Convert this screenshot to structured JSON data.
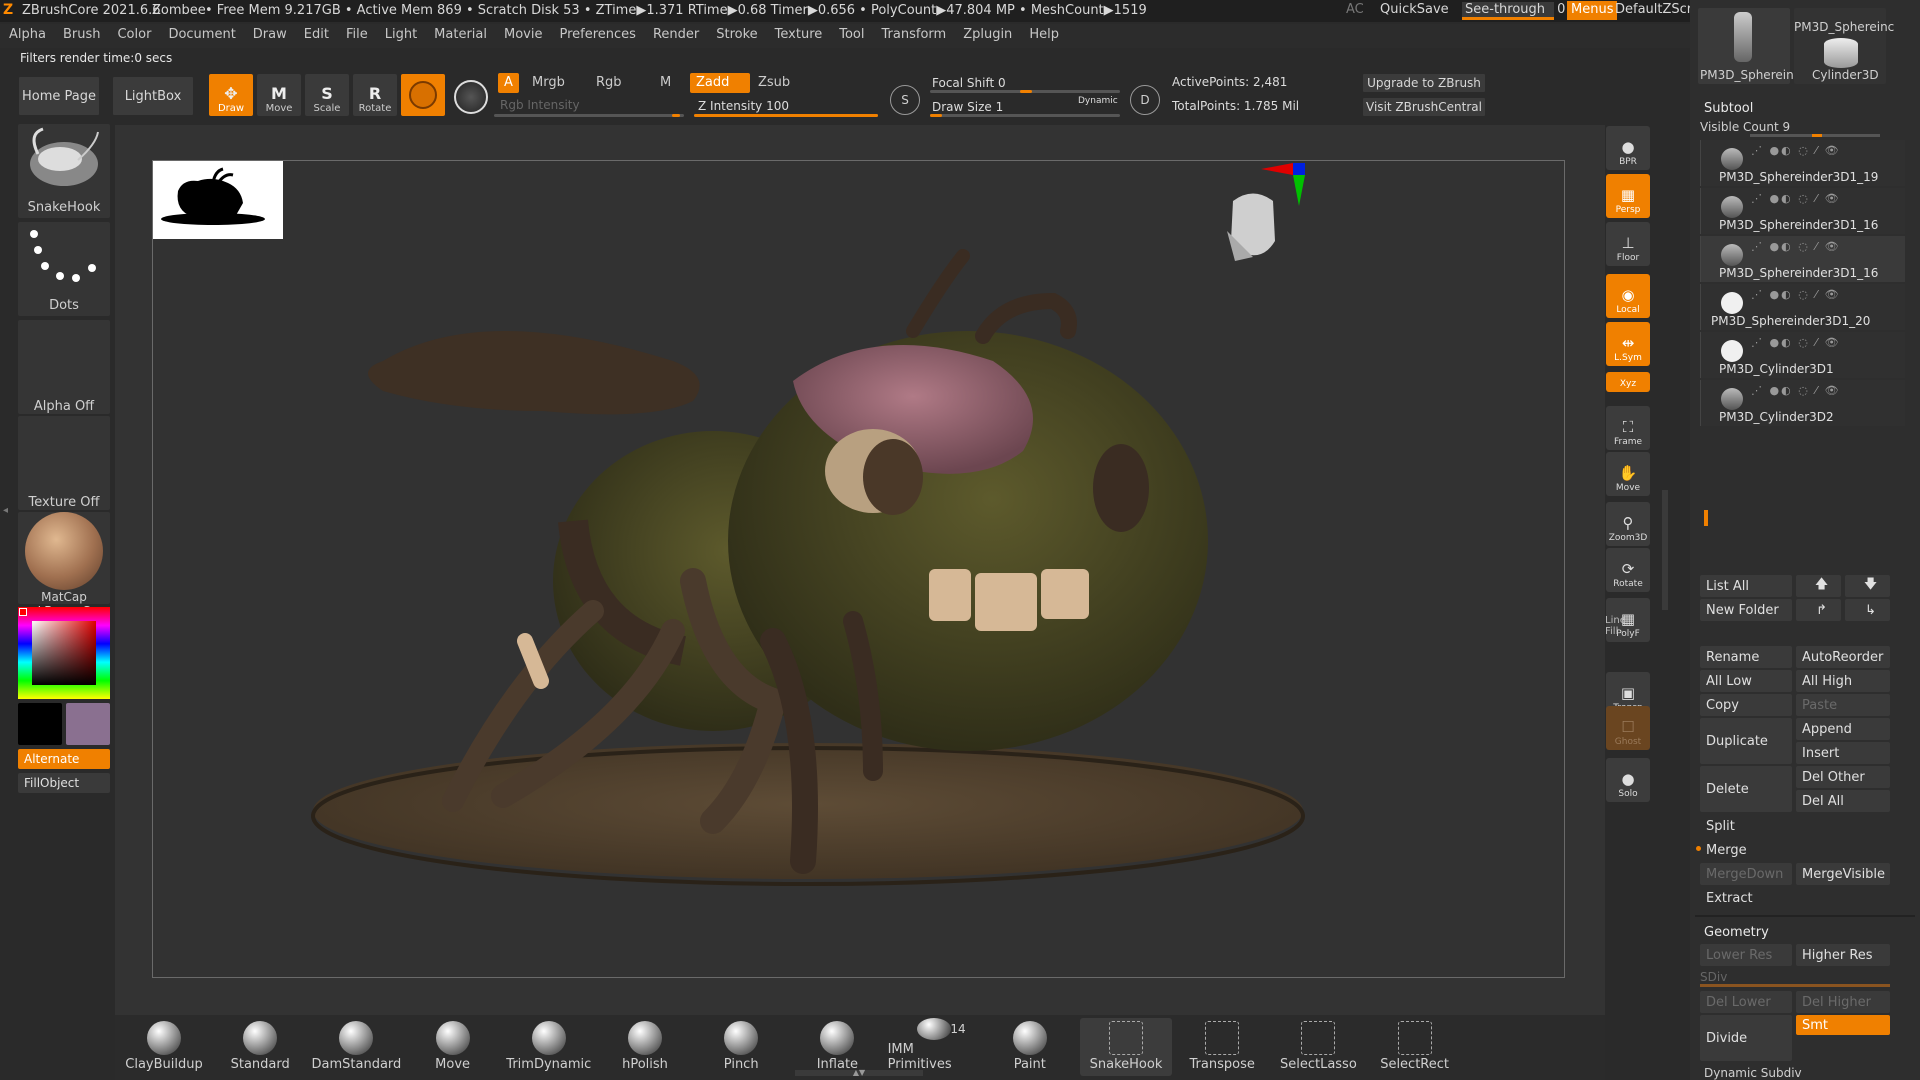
{
  "titlebar": {
    "app": "ZBrushCore 2021.6.6",
    "project": "Zombee",
    "stats": "• Free Mem 9.217GB • Active Mem 869 • Scratch Disk 53 • ZTime▶1.371 RTime▶0.68 Timer▶0.656 • PolyCount▶47.804 MP • MeshCount▶1519",
    "ac": "AC",
    "quicksave": "QuickSave",
    "see_through": "See-through",
    "see_through_value": "0",
    "menus": "Menus",
    "script": "DefaultZScript"
  },
  "menubar": [
    "Alpha",
    "Brush",
    "Color",
    "Document",
    "Draw",
    "Edit",
    "File",
    "Light",
    "Material",
    "Movie",
    "Preferences",
    "Render",
    "Stroke",
    "Texture",
    "Tool",
    "Transform",
    "Zplugin",
    "Help"
  ],
  "render_info": "Filters render time:0 secs",
  "toolbar": {
    "home_page": "Home Page",
    "lightbox": "LightBox",
    "tools": [
      {
        "label": "Draw",
        "glyph": "✥",
        "on": true
      },
      {
        "label": "Move",
        "glyph": "M",
        "on": false
      },
      {
        "label": "Scale",
        "glyph": "S",
        "on": false
      },
      {
        "label": "Rotate",
        "glyph": "R",
        "on": false
      }
    ],
    "a": "A",
    "mrgb": "Mrgb",
    "rgb": "Rgb",
    "m": "M",
    "rgb_intensity": "Rgb Intensity",
    "zadd": "Zadd",
    "zsub": "Zsub",
    "z_intensity": "Z Intensity 100",
    "s_letter": "S",
    "focal_shift": "Focal Shift 0",
    "draw_size": "Draw Size 1",
    "dynamic": "Dynamic",
    "d_letter": "D",
    "active_points": "ActivePoints: 2,481",
    "total_points": "TotalPoints: 1.785 Mil",
    "upgrade": "Upgrade to ZBrush",
    "visit": "Visit ZBrushCentral"
  },
  "left_shelf": {
    "brush": "SnakeHook",
    "stroke": "Dots",
    "alpha": "Alpha Off",
    "texture": "Texture Off",
    "material": "MatCap LBrownC",
    "alternate": "Alternate",
    "fillobject": "FillObject",
    "secondary_color": "#8a7090"
  },
  "right_shelf": [
    {
      "label": "BPR",
      "glyph": "●",
      "on": false
    },
    {
      "label": "Persp",
      "glyph": "▦",
      "on": true
    },
    {
      "label": "Floor",
      "glyph": "⊥",
      "on": false
    },
    {
      "label": "Local",
      "glyph": "◉",
      "on": true
    },
    {
      "label": "L.Sym",
      "glyph": "⇹",
      "on": true
    },
    {
      "label": "Xyz",
      "glyph": "",
      "on": true
    },
    {
      "label": "Frame",
      "glyph": "⛶",
      "on": false
    },
    {
      "label": "Move",
      "glyph": "✋",
      "on": false
    },
    {
      "label": "Zoom3D",
      "glyph": "⚲",
      "on": false
    },
    {
      "label": "Rotate",
      "glyph": "⟳",
      "on": false
    },
    {
      "label": "PolyF",
      "glyph": "▦",
      "on": false
    },
    {
      "label": "Transp",
      "glyph": "▣",
      "on": false
    },
    {
      "label": "Ghost",
      "glyph": "☐",
      "on": false
    },
    {
      "label": "Solo",
      "glyph": "●",
      "on": false
    }
  ],
  "line_fill": "Line Fill",
  "subtool_panel": {
    "thumbs": [
      "PM3D_Sphereinc",
      "Cylinder3D"
    ],
    "thumb_top": "PM3D_Sphereinc",
    "title": "Subtool",
    "visible_count": "Visible Count 9",
    "items": [
      "PM3D_Sphereinder3D1_19",
      "PM3D_Sphereinder3D1_16",
      "PM3D_Sphereinder3D1_16",
      "PM3D_Sphereinder3D1_20",
      "PM3D_Cylinder3D1",
      "PM3D_Cylinder3D2"
    ],
    "list_all": "List All",
    "new_folder": "New Folder",
    "rename": "Rename",
    "autoreorder": "AutoReorder",
    "all_low": "All Low",
    "all_high": "All High",
    "copy": "Copy",
    "paste": "Paste",
    "duplicate": "Duplicate",
    "append": "Append",
    "insert": "Insert",
    "delete": "Delete",
    "del_other": "Del Other",
    "del_all": "Del All",
    "split": "Split",
    "merge": "Merge",
    "mergedown": "MergeDown",
    "mergevisible": "MergeVisible",
    "extract": "Extract"
  },
  "geometry_panel": {
    "title": "Geometry",
    "lower_res": "Lower Res",
    "higher_res": "Higher Res",
    "sdiv": "SDiv",
    "del_lower": "Del Lower",
    "del_higher": "Del Higher",
    "divide": "Divide",
    "smt": "Smt",
    "dynamic_subdiv": "Dynamic Subdiv"
  },
  "bottom_brushes": [
    {
      "label": "ClayBuildup",
      "sel": false
    },
    {
      "label": "Standard",
      "sel": false
    },
    {
      "label": "DamStandard",
      "sel": false
    },
    {
      "label": "Move",
      "sel": false
    },
    {
      "label": "TrimDynamic",
      "sel": false
    },
    {
      "label": "hPolish",
      "sel": false
    },
    {
      "label": "Pinch",
      "sel": false
    },
    {
      "label": "Inflate",
      "sel": false
    },
    {
      "label": "IMM Primitives",
      "sel": false
    },
    {
      "label": "Paint",
      "sel": false
    },
    {
      "label": "SnakeHook",
      "sel": true
    },
    {
      "label": "Transpose",
      "sel": false
    },
    {
      "label": "SelectLasso",
      "sel": false
    },
    {
      "label": "SelectRect",
      "sel": false
    }
  ],
  "imm_count": "14",
  "colors": {
    "accent": "#f08000",
    "panel": "#2e2e2e",
    "viewport": "#333333"
  }
}
